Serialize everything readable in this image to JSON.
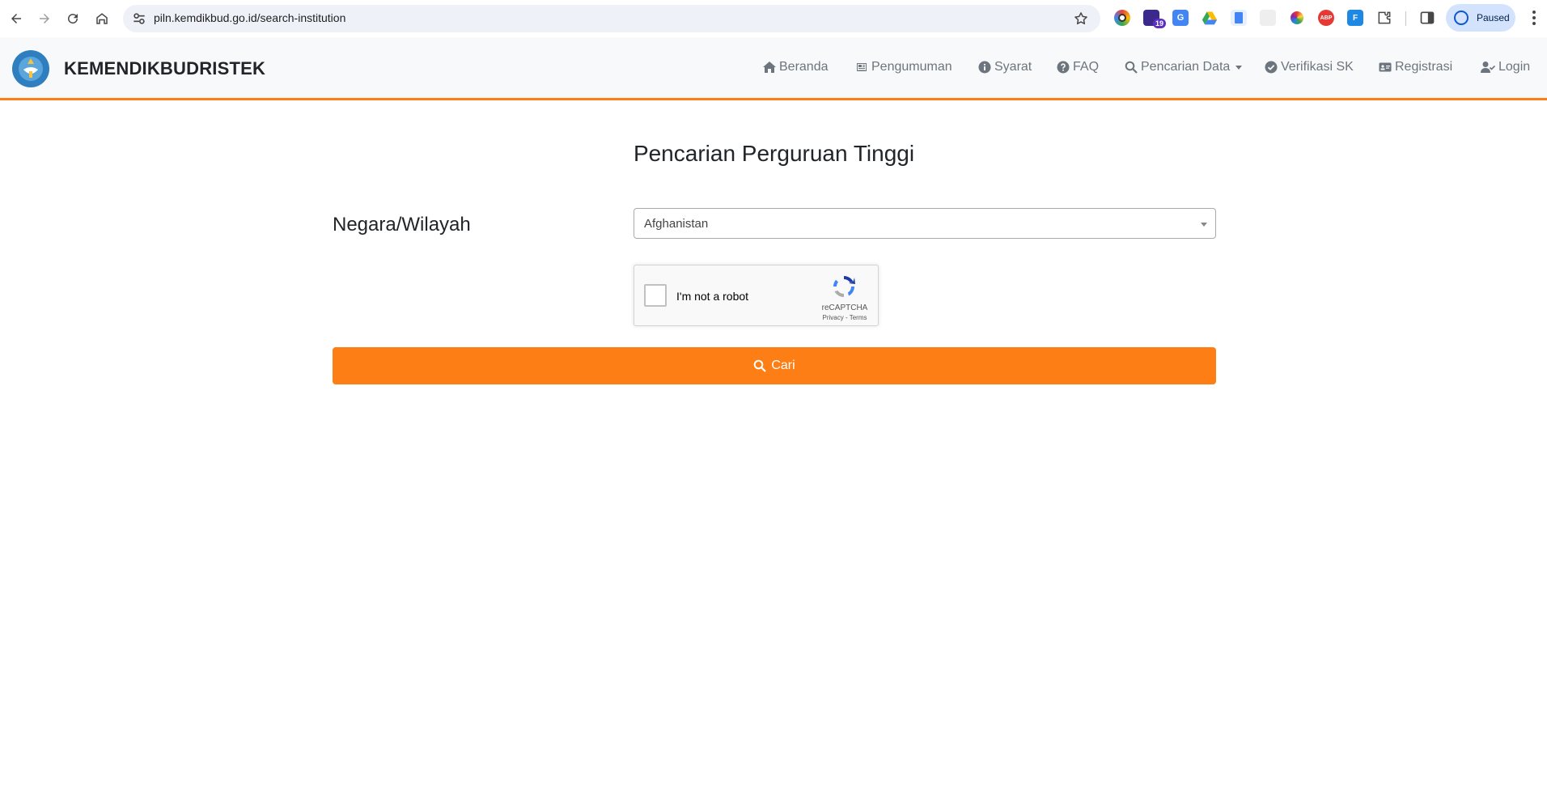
{
  "browser": {
    "url": "piln.kemdikbud.go.id/search-institution",
    "extension_badge": "19",
    "profile_label": "Paused"
  },
  "site": {
    "brand": "KEMENDIKBUDRISTEK",
    "accent_color": "#fd7e14",
    "nav": [
      {
        "label": "Beranda",
        "icon": "home-icon"
      },
      {
        "label": "Pengumuman",
        "icon": "newspaper-icon"
      },
      {
        "label": "Syarat",
        "icon": "info-circle-icon"
      },
      {
        "label": "FAQ",
        "icon": "question-circle-icon"
      },
      {
        "label": "Pencarian Data",
        "icon": "search-icon",
        "dropdown": true
      },
      {
        "label": "Verifikasi SK",
        "icon": "check-circle-icon"
      },
      {
        "label": "Registrasi",
        "icon": "id-card-icon"
      },
      {
        "label": "Login",
        "icon": "user-check-icon"
      }
    ]
  },
  "main": {
    "title": "Pencarian Perguruan Tinggi",
    "country_label": "Negara/Wilayah",
    "country_value": "Afghanistan",
    "recaptcha": {
      "label": "I'm not a robot",
      "brand": "reCAPTCHA",
      "links": "Privacy - Terms"
    },
    "search_button": "Cari"
  }
}
